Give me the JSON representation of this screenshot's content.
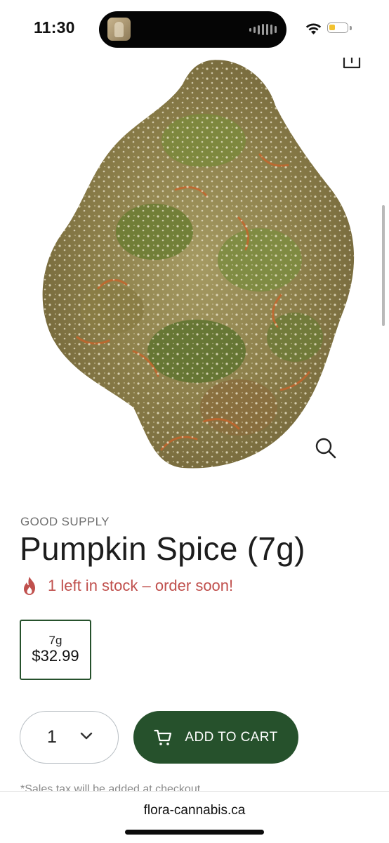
{
  "status_bar": {
    "time": "11:30",
    "battery_level": 0.35,
    "battery_color": "#f2c230"
  },
  "product": {
    "brand": "GOOD SUPPLY",
    "name": "Pumpkin Spice (7g)",
    "stock_message": "1 left in stock – order soon!",
    "stock_icon": "fire-icon",
    "variant": {
      "weight": "7g",
      "price": "$32.99",
      "selected": true
    }
  },
  "purchase": {
    "quantity": "1",
    "add_to_cart_label": "ADD TO CART",
    "tax_note": "*Sales tax will be added at checkout"
  },
  "browser": {
    "url": "flora-cannabis.ca"
  },
  "colors": {
    "brand_green": "#26512c",
    "stock_red": "#c0504d",
    "muted_text": "#6f6f6f"
  },
  "icons": [
    "share-icon",
    "zoom-icon",
    "fire-icon",
    "chevron-down-icon",
    "cart-icon",
    "wifi-icon",
    "battery-icon"
  ]
}
